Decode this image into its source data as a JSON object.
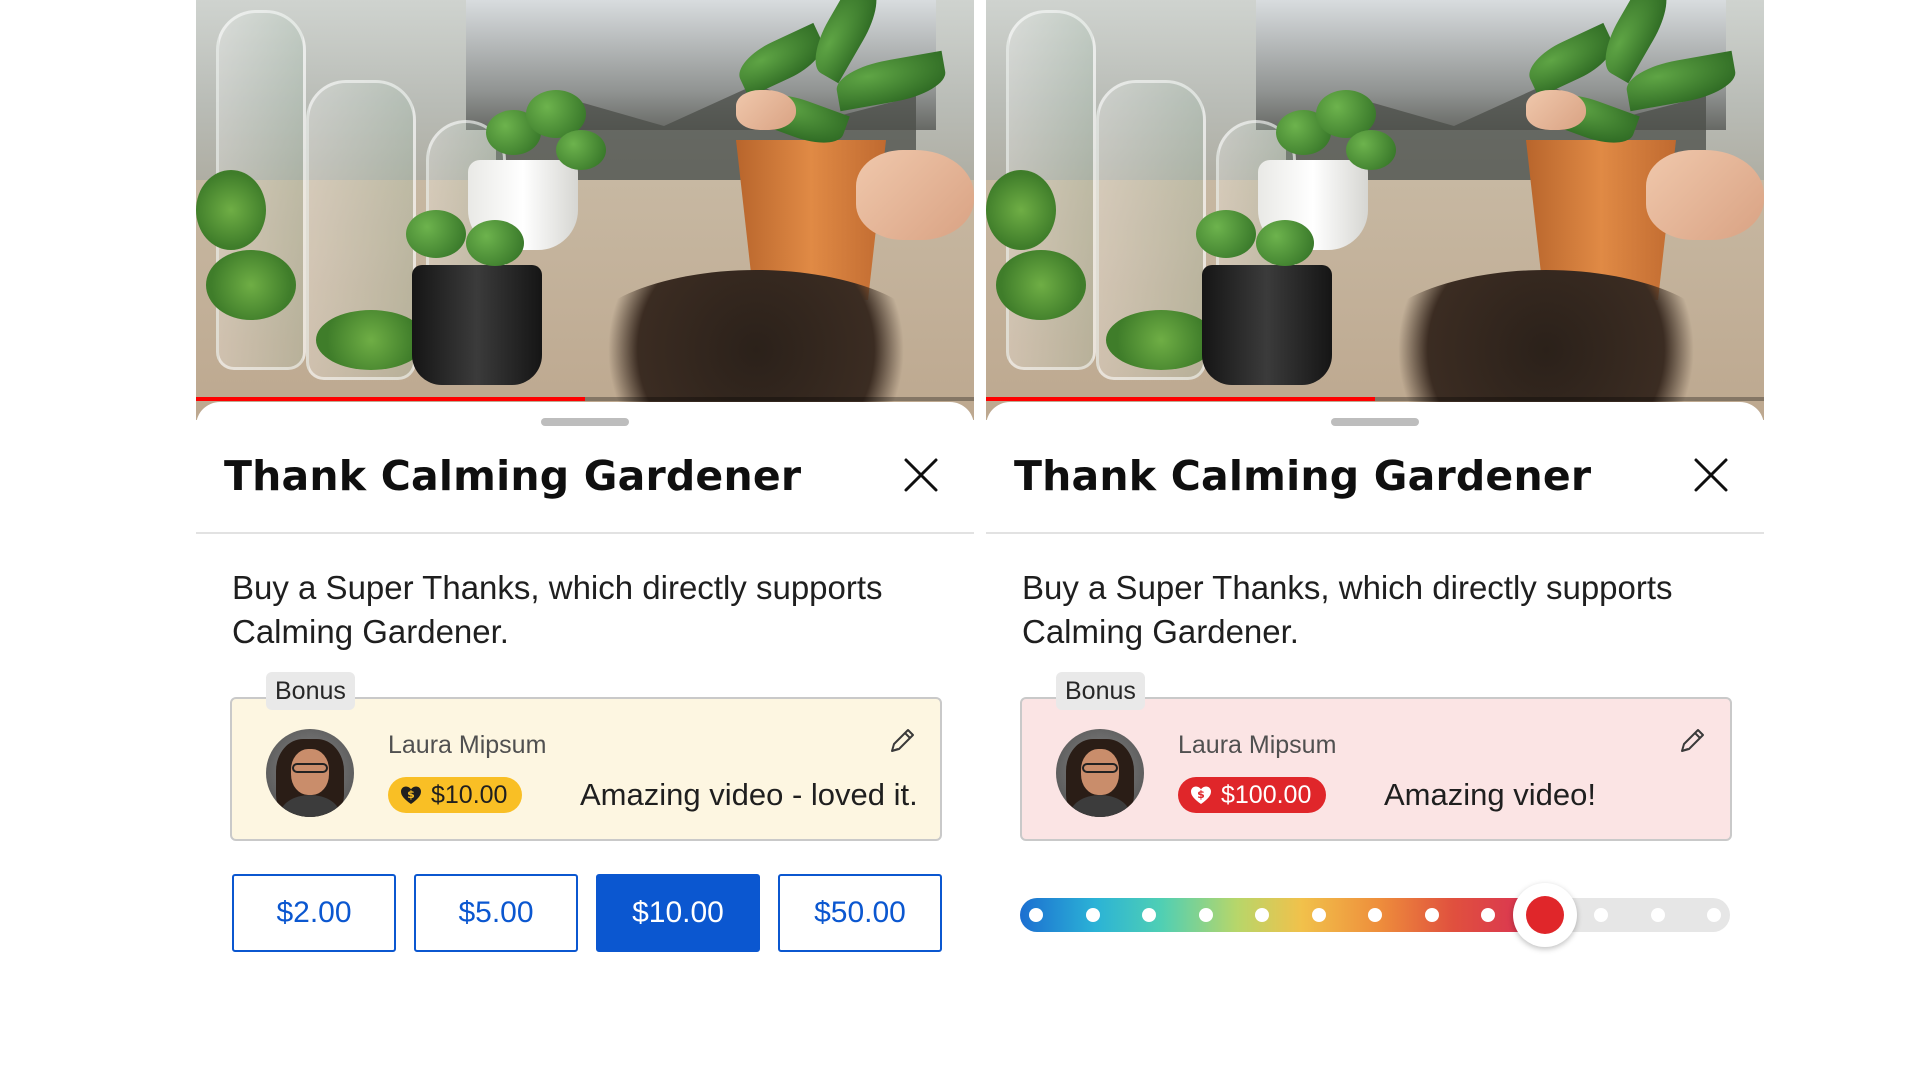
{
  "left_panel": {
    "video": {
      "progress_fraction": 0.5
    },
    "sheet": {
      "title": "Thank Calming Gardener",
      "description": "Buy a Super Thanks, which directly supports Calming Gardener.",
      "bonus_label": "Bonus",
      "comment": {
        "author": "Laura Mipsum",
        "amount": "$10.00",
        "message": "Amazing video - loved it.",
        "card_color": "#fdf6e1",
        "badge_color": "#f9bf25"
      },
      "amount_options": [
        {
          "label": "$2.00",
          "selected": false
        },
        {
          "label": "$5.00",
          "selected": false
        },
        {
          "label": "$10.00",
          "selected": true
        },
        {
          "label": "$50.00",
          "selected": false
        }
      ]
    }
  },
  "right_panel": {
    "video": {
      "progress_fraction": 0.5
    },
    "sheet": {
      "title": "Thank Calming Gardener",
      "description": "Buy a Super Thanks, which directly supports Calming Gardener.",
      "bonus_label": "Bonus",
      "comment": {
        "author": "Laura Mipsum",
        "amount": "$100.00",
        "message": "Amazing video!",
        "card_color": "#fbe4e4",
        "badge_color": "#e0262a"
      },
      "amount_slider": {
        "stops": 13,
        "selected_index": 9,
        "colors": [
          "#1c6fd1",
          "#2bb3d6",
          "#4fcfb4",
          "#b7d66a",
          "#f1c14b",
          "#ee8f3c",
          "#e0503e",
          "#d8285c"
        ],
        "thumb_color": "#e0262a"
      }
    }
  },
  "icons": {
    "close": "close-icon",
    "edit": "pencil-icon",
    "super_thanks_badge": "heart-dollar-icon",
    "drag_handle": "drag-handle"
  },
  "accent_colors": {
    "primary_blue": "#0b57d0",
    "progress_red": "#ff0000"
  }
}
